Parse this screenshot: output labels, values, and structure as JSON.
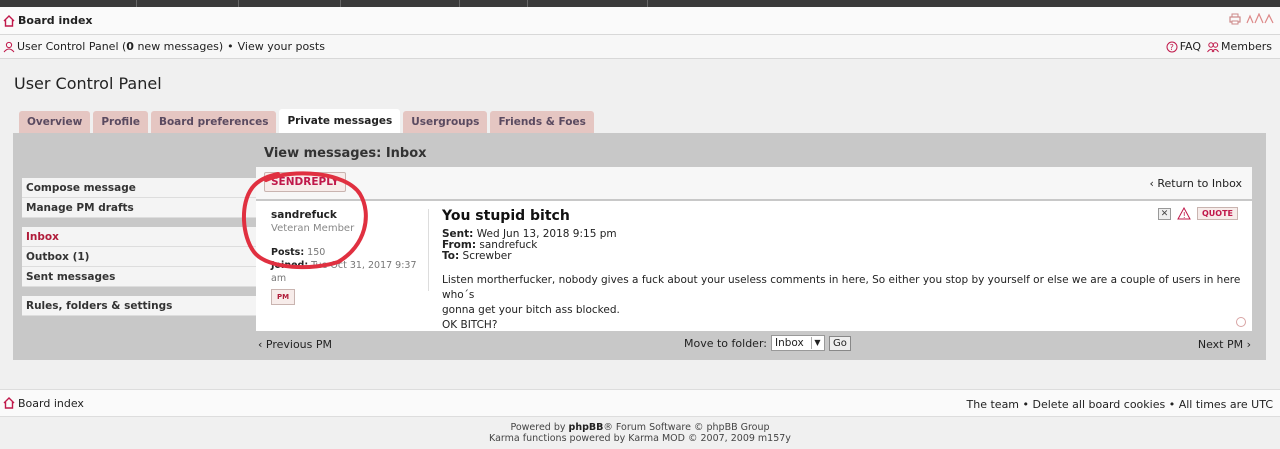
{
  "header": {
    "board_index": "Board index"
  },
  "subheader": {
    "ucp_prefix": "User Control Panel (",
    "new_count": "0",
    "ucp_suffix": " new messages)",
    "bullet": "•",
    "view_posts": "View your posts",
    "faq": "FAQ",
    "members": "Members"
  },
  "page_title": "User Control Panel",
  "tabs": [
    {
      "label": "Overview"
    },
    {
      "label": "Profile"
    },
    {
      "label": "Board preferences"
    },
    {
      "label": "Private messages"
    },
    {
      "label": "Usergroups"
    },
    {
      "label": "Friends & Foes"
    }
  ],
  "menu": {
    "compose": "Compose message",
    "drafts": "Manage PM drafts",
    "inbox": "Inbox",
    "outbox": "Outbox (1)",
    "sent": "Sent messages",
    "rules": "Rules, folders & settings"
  },
  "view_title": "View messages: Inbox",
  "action_bar": {
    "reply_btn": "SENDREPLY",
    "return_link": "‹ Return to Inbox"
  },
  "post": {
    "author": "sandrefuck",
    "rank": "Veteran Member",
    "posts_label": "Posts:",
    "posts_value": "150",
    "joined_label": "Joined:",
    "joined_value": "Tue Oct 31, 2017 9:37 am",
    "pm_btn": "PM",
    "subject": "You stupid bitch",
    "sent_label": "Sent:",
    "sent_value": "Wed Jun 13, 2018 9:15 pm",
    "from_label": "From:",
    "from_value": "sandrefuck",
    "to_label": "To:",
    "to_value": "Screwber",
    "body_line1": "Listen mortherfucker, nobody gives a fuck about your useless comments in here, So either you stop by yourself or else we are a couple of users in here who´s",
    "body_line2": "gonna get your bitch ass blocked.",
    "body_line3": "OK BITCH?",
    "quote_btn": "QUOTE"
  },
  "nav": {
    "prev": "‹ Previous PM",
    "next": "Next PM ›",
    "move_label": "Move to folder:",
    "folder": "Inbox",
    "go": "Go"
  },
  "footer": {
    "board_index": "Board index",
    "team": "The team",
    "cookies": "Delete all board cookies",
    "times": "All times are UTC",
    "powered_prefix": "Powered by ",
    "phpbb": "phpBB",
    "powered_suffix": "® Forum Software © phpBB Group",
    "karma": "Karma functions powered by Karma MOD © 2007, 2009 m157y"
  },
  "colors": {
    "tab_bg": "#e5c6c2",
    "accent_red": "#c0184a",
    "panel_bg": "#c8c8c8",
    "annotation": "#e03040"
  }
}
